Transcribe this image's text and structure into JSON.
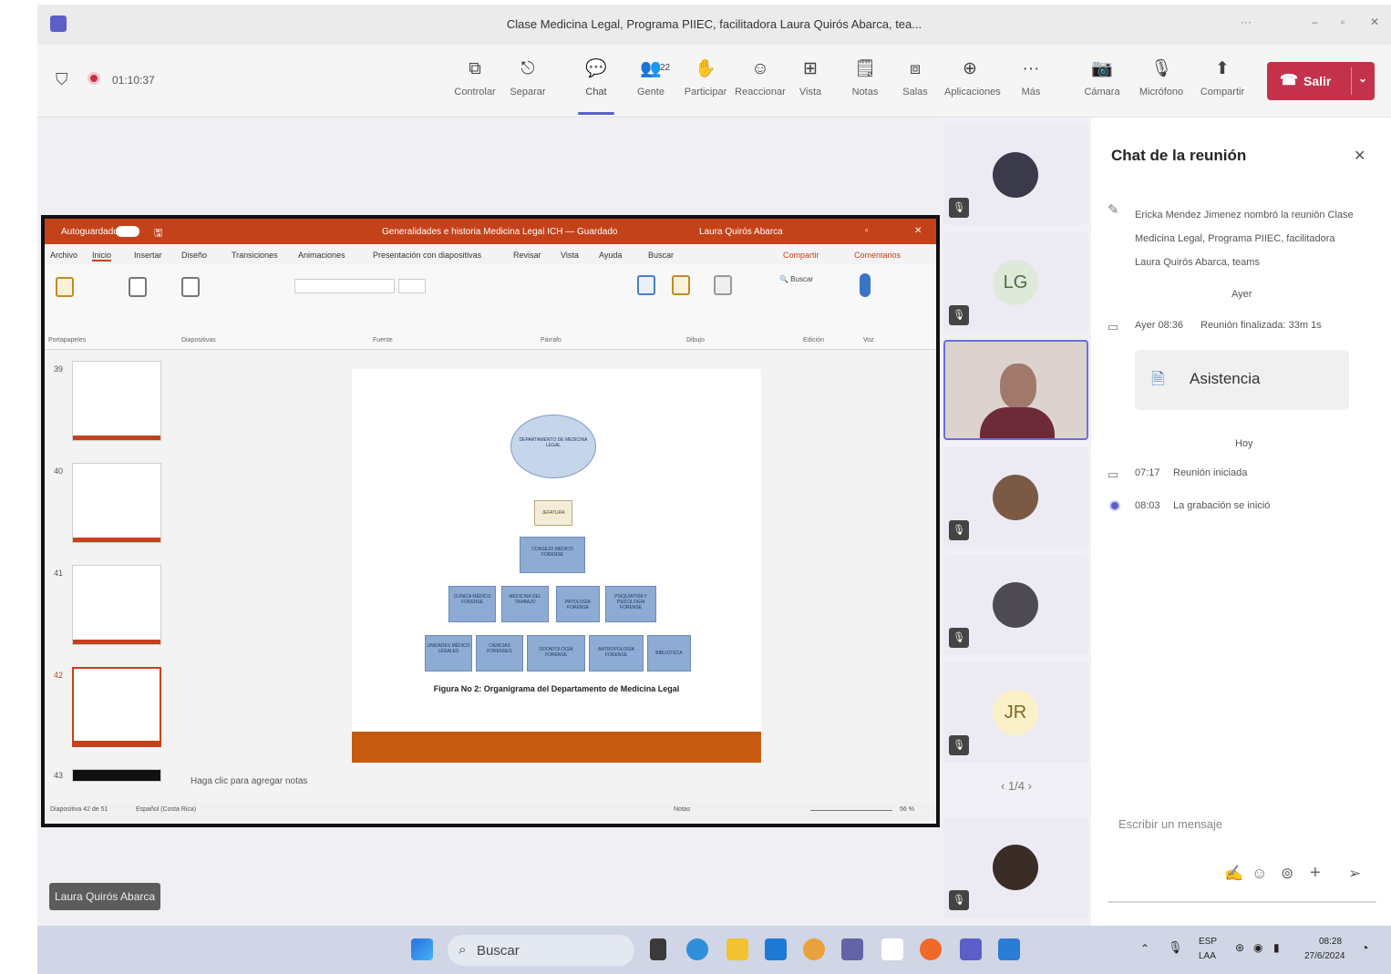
{
  "window": {
    "title": "Clase Medicina Legal, Programa PIIEC, facilitadora Laura Quirós Abarca, tea...",
    "more": "···",
    "minimize": "–",
    "maximize": "▫",
    "close": "✕"
  },
  "meeting": {
    "timer": "01:10:37",
    "toolbar": [
      {
        "icon": "control-icon",
        "glyph": "⧉",
        "label": "Controlar"
      },
      {
        "icon": "pop-out-icon",
        "glyph": "⎋",
        "label": "Separar"
      },
      {
        "icon": "chat-icon",
        "glyph": "💬",
        "label": "Chat",
        "active": true
      },
      {
        "icon": "people-icon",
        "glyph": "👥",
        "label": "Gente",
        "badge": "22"
      },
      {
        "icon": "raise-hand-icon",
        "glyph": "✋",
        "label": "Participar"
      },
      {
        "icon": "react-icon",
        "glyph": "☺",
        "label": "Reaccionar"
      },
      {
        "icon": "view-icon",
        "glyph": "⊞",
        "label": "Vista"
      },
      {
        "icon": "notes-icon",
        "glyph": "🗒",
        "label": "Notas"
      },
      {
        "icon": "rooms-icon",
        "glyph": "⧈",
        "label": "Salas"
      },
      {
        "icon": "apps-icon",
        "glyph": "⊕",
        "label": "Aplicaciones"
      },
      {
        "icon": "more-icon",
        "glyph": "···",
        "label": "Más"
      }
    ],
    "media": [
      {
        "icon": "camera-off-icon",
        "glyph": "📷",
        "label": "Cámara"
      },
      {
        "icon": "mic-off-icon",
        "glyph": "🎙",
        "label": "Micrófono"
      },
      {
        "icon": "share-icon",
        "glyph": "⬆",
        "label": "Compartir"
      }
    ],
    "leave_label": "Salir"
  },
  "ppt": {
    "autosave": "Autoguardado",
    "doc_title": "Generalidades e historia Medicina Legal ICH — Guardado",
    "user": "Laura Quirós Abarca",
    "menu": [
      "Archivo",
      "Inicio",
      "Insertar",
      "Diseño",
      "Transiciones",
      "Animaciones",
      "Presentación con diapositivas",
      "Revisar",
      "Vista",
      "Ayuda",
      "Buscar"
    ],
    "share_btn": "Compartir",
    "comments_btn": "Comentarios",
    "groups": [
      "Portapapeles",
      "Diapositivas",
      "Fuente",
      "Párrafo",
      "Dibujo",
      "Edición",
      "Voz"
    ],
    "thumb_nums": [
      "39",
      "40",
      "41",
      "42",
      "43"
    ],
    "slide": {
      "top_node": "DEPARTAMENTO DE MEDICINA LEGAL",
      "jefatura": "JEFATURA",
      "consejo": "CONSEJO MÉDICO FORENSE",
      "row1": [
        "CLÍNICA MÉDICO FORENSE",
        "MEDICINA DEL TRABAJO",
        "PATOLOGÍA FORENSE",
        "PSIQUIATRÍA Y PSICOLOGÍA FORENSE"
      ],
      "row2": [
        "UNIDADES MÉDICO LEGALES",
        "CIENCIAS FORENSES",
        "ODONTOLOGÍA FORENSE",
        "ANTROPOLOGÍA FORENSE",
        "BIBLIOTECA"
      ],
      "caption": "Figura No 2: Organigrama del Departamento de Medicina Legal"
    },
    "notes_placeholder": "Haga clic para agregar notas",
    "status_left": "Diapositiva 42 de 51",
    "status_lang": "Español (Costa Rica)",
    "notes_btn": "Notas",
    "zoom": "56 %"
  },
  "presenter_name": "Laura Quirós Abarca",
  "participants": {
    "initials": [
      "LG",
      "JR"
    ],
    "pager": "1/4"
  },
  "chat": {
    "title": "Chat de la reunión",
    "rename_event": "Ericka Mendez Jimenez nombró la reunión Clase Medicina Legal, Programa PIIEC, facilitadora Laura Quirós Abarca, teams",
    "yesterday": "Ayer",
    "ended_time": "Ayer 08:36",
    "ended_text": "Reunión finalizada: 33m 1s",
    "attendance": "Asistencia",
    "today": "Hoy",
    "started_time": "07:17",
    "started_text": "Reunión iniciada",
    "rec_time": "08:03",
    "rec_text": "La grabación se inició",
    "compose_placeholder": "Escribir un mensaje"
  },
  "taskbar": {
    "search": "Buscar",
    "lang1": "ESP",
    "lang2": "LAA",
    "time": "08:28",
    "date": "27/6/2024"
  }
}
